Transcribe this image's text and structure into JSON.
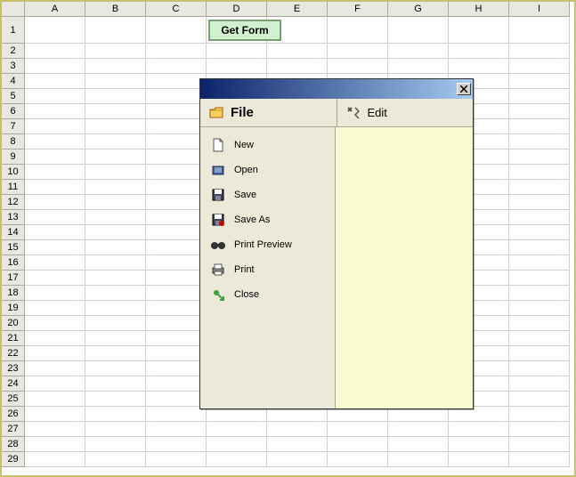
{
  "columns": [
    "A",
    "B",
    "C",
    "D",
    "E",
    "F",
    "G",
    "H",
    "I"
  ],
  "rows": [
    "1",
    "2",
    "3",
    "4",
    "5",
    "6",
    "7",
    "8",
    "9",
    "10",
    "11",
    "12",
    "13",
    "14",
    "15",
    "16",
    "17",
    "18",
    "19",
    "20",
    "21",
    "22",
    "23",
    "24",
    "25",
    "26",
    "27",
    "28",
    "29"
  ],
  "button": {
    "label": "Get Form"
  },
  "dialog": {
    "tabs": [
      {
        "id": "file",
        "label": "File",
        "icon": "folder-icon",
        "active": true
      },
      {
        "id": "edit",
        "label": "Edit",
        "icon": "tools-icon",
        "active": false
      }
    ],
    "menu": [
      {
        "id": "new",
        "label": "New",
        "icon": "new-icon"
      },
      {
        "id": "open",
        "label": "Open",
        "icon": "open-icon"
      },
      {
        "id": "save",
        "label": "Save",
        "icon": "save-icon"
      },
      {
        "id": "saveas",
        "label": "Save As",
        "icon": "saveas-icon"
      },
      {
        "id": "printpreview",
        "label": "Print Preview",
        "icon": "binoculars-icon"
      },
      {
        "id": "print",
        "label": "Print",
        "icon": "printer-icon"
      },
      {
        "id": "close",
        "label": "Close",
        "icon": "exit-icon"
      }
    ]
  }
}
